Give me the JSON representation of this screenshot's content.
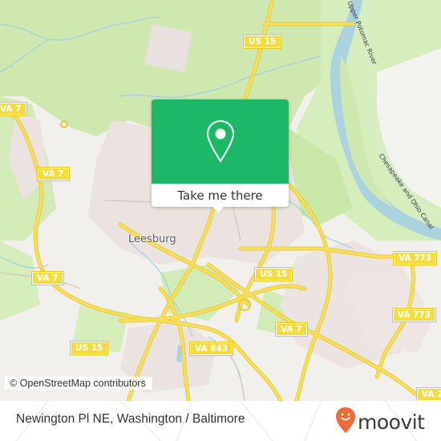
{
  "map": {
    "place_labels": [
      {
        "name": "Leesburg"
      }
    ],
    "water_labels": [
      {
        "name": "Upper Potomac River"
      },
      {
        "name": "Chesapeake and Ohio Canal"
      }
    ],
    "route_shields": [
      {
        "label": "US 15"
      },
      {
        "label": "VA 7"
      },
      {
        "label": "VA 7"
      },
      {
        "label": "VA 7"
      },
      {
        "label": "US 15"
      },
      {
        "label": "VA 773"
      },
      {
        "label": "VA 773"
      },
      {
        "label": "US 15"
      },
      {
        "label": "VA 643"
      },
      {
        "label": "VA 7"
      },
      {
        "label": "VA 7"
      },
      {
        "label": "VA 2"
      }
    ],
    "attribution": "© OpenStreetMap contributors",
    "colors": {
      "forest": "#c8e6a8",
      "urban": "#ebe2df",
      "water": "#aad3df",
      "road": "#f7df5a",
      "background": "#f2f0ec"
    }
  },
  "popup": {
    "icon": "map-pin-icon",
    "button_label": "Take me there",
    "accent_color": "#1db867"
  },
  "footer": {
    "location_title": "Newington Pl NE, Washington / Baltimore",
    "brand": "moovit",
    "brand_icon": "moovit-pin-logo-icon",
    "brand_color": "#f06a3a"
  }
}
